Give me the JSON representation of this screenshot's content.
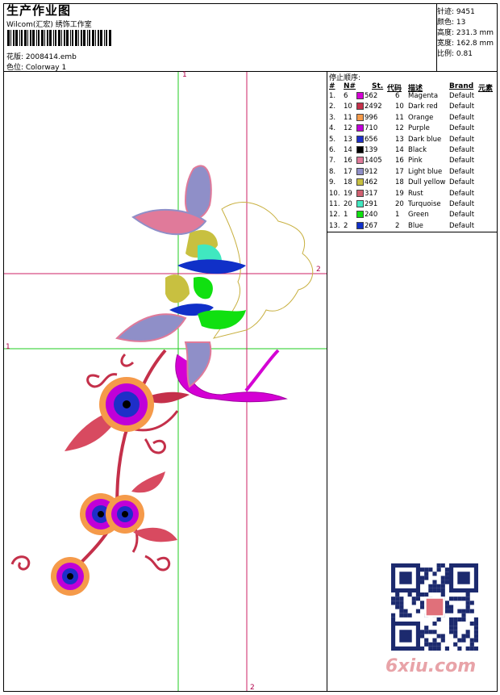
{
  "header": {
    "title": "生产作业图",
    "subtitle": "Wilcom(汇宏) 绣饰工作室",
    "design_label": "花版: 2008414.emb",
    "colorway_label": "色位: Colorway 1"
  },
  "stats": {
    "stitches": "针迹: 9451",
    "colors": "颜色: 13",
    "height": "高度: 231.3 mm",
    "width": "宽度: 162.8 mm",
    "ratio": "比例: 0.81"
  },
  "stop_sequence": {
    "title": "停止顺序:",
    "headers": {
      "hash": "#",
      "n": "N#",
      "st": "St.",
      "code": "代码",
      "desc": "描述",
      "brand": "Brand",
      "element": "元素"
    },
    "rows": [
      {
        "idx": "1.",
        "n": "6",
        "color": "#d400d4",
        "st": "562",
        "code": "6",
        "desc": "Magenta",
        "brand": "Default"
      },
      {
        "idx": "2.",
        "n": "10",
        "color": "#c4304a",
        "st": "2492",
        "code": "10",
        "desc": "Dark red",
        "brand": "Default"
      },
      {
        "idx": "3.",
        "n": "11",
        "color": "#f59a4a",
        "st": "996",
        "code": "11",
        "desc": "Orange",
        "brand": "Default"
      },
      {
        "idx": "4.",
        "n": "12",
        "color": "#c000d8",
        "st": "710",
        "code": "12",
        "desc": "Purple",
        "brand": "Default"
      },
      {
        "idx": "5.",
        "n": "13",
        "color": "#1e2fc8",
        "st": "656",
        "code": "13",
        "desc": "Dark blue",
        "brand": "Default"
      },
      {
        "idx": "6.",
        "n": "14",
        "color": "#000000",
        "st": "139",
        "code": "14",
        "desc": "Black",
        "brand": "Default"
      },
      {
        "idx": "7.",
        "n": "16",
        "color": "#e07a9a",
        "st": "1405",
        "code": "16",
        "desc": "Pink",
        "brand": "Default"
      },
      {
        "idx": "8.",
        "n": "17",
        "color": "#8f8fc8",
        "st": "912",
        "code": "17",
        "desc": "Light blue",
        "brand": "Default"
      },
      {
        "idx": "9.",
        "n": "18",
        "color": "#c8c040",
        "st": "462",
        "code": "18",
        "desc": "Dull yellow",
        "brand": "Default"
      },
      {
        "idx": "10.",
        "n": "19",
        "color": "#d06070",
        "st": "317",
        "code": "19",
        "desc": "Rust",
        "brand": "Default"
      },
      {
        "idx": "11.",
        "n": "20",
        "color": "#40e8c0",
        "st": "291",
        "code": "20",
        "desc": "Turquoise",
        "brand": "Default"
      },
      {
        "idx": "12.",
        "n": "1",
        "color": "#10e010",
        "st": "240",
        "code": "1",
        "desc": "Green",
        "brand": "Default"
      },
      {
        "idx": "13.",
        "n": "2",
        "color": "#1030c8",
        "st": "267",
        "code": "2",
        "desc": "Blue",
        "brand": "Default"
      }
    ]
  },
  "canvas": {
    "axis_label_1": "1",
    "axis_label_2": "2"
  },
  "watermark": {
    "site": "6xiu.com"
  }
}
